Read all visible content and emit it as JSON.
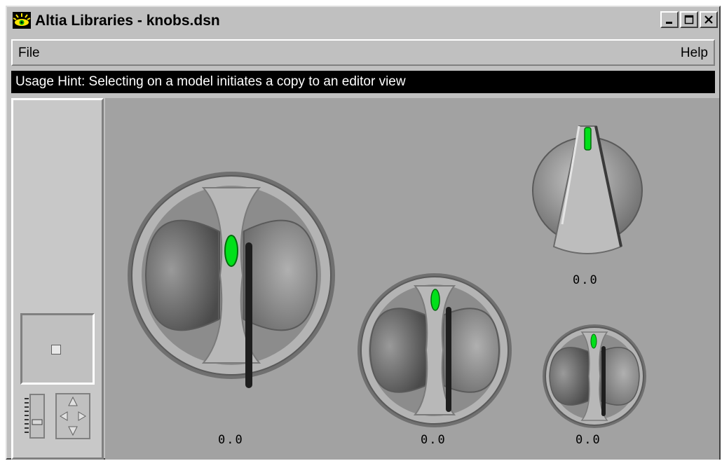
{
  "window": {
    "title": "Altia Libraries - knobs.dsn",
    "title_color": "#c0c0c0"
  },
  "menu": {
    "file_label": "File",
    "help_label": "Help"
  },
  "hint": {
    "text": "Usage Hint:  Selecting on a model initiates a copy to an editor view"
  },
  "knobs": [
    {
      "name": "knob-large",
      "value": "0.0",
      "indicator_color": "#00e01a"
    },
    {
      "name": "knob-medium",
      "value": "0.0",
      "indicator_color": "#00e01a"
    },
    {
      "name": "knob-pointer",
      "value": "0.0",
      "indicator_color": "#00e01a"
    },
    {
      "name": "knob-small",
      "value": "0.0",
      "indicator_color": "#00e01a"
    }
  ],
  "icons": [
    "altia-eye-icon",
    "minimize-icon",
    "maximize-icon",
    "close-icon",
    "zoom-slider-icon",
    "pan-arrows-icon"
  ]
}
